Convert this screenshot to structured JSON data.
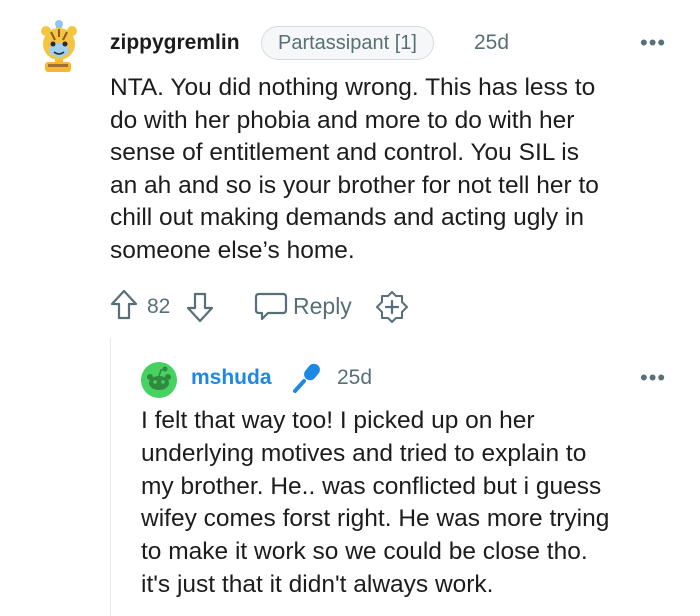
{
  "comment": {
    "username": "zippygremlin",
    "flair": "Partassipant [1]",
    "time": "25d",
    "more_label": "•••",
    "body_lines": [
      "NTA. You did nothing wrong. This has less to",
      "do with her phobia and more to do with her",
      "sense of entitlement and control. You SIL is",
      "an ah and so is your brother for not tell her to",
      "chill out making demands and acting ugly in",
      "someone else’s home."
    ],
    "score": "82",
    "reply_label": "Reply"
  },
  "reply": {
    "username": "mshuda",
    "time": "25d",
    "more_label": "•••",
    "body_lines": [
      "I felt that way too! I picked up on her",
      "underlying motives and tried to explain to",
      "my brother. He.. was conflicted but i guess",
      "wifey comes forst right. He was more trying",
      "to make it work so we could be close tho.",
      "it's just that it didn't always work."
    ]
  },
  "colors": {
    "text": "#1c1c1c",
    "meta": "#576f76",
    "op_username": "#1e88e5",
    "thread_line": "#e5e7e9",
    "avatar_green": "#46d160"
  }
}
